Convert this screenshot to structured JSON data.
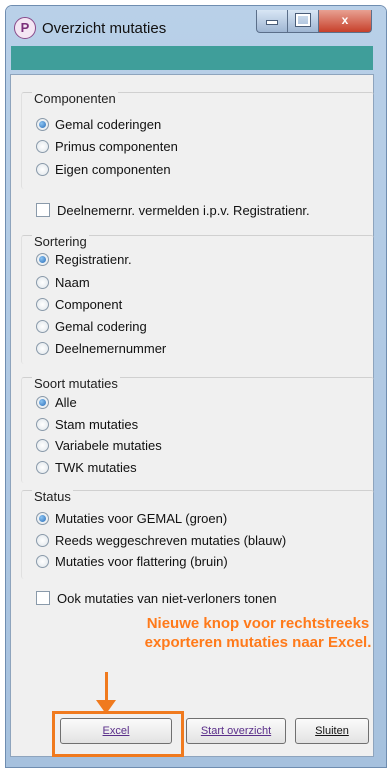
{
  "window": {
    "title": "Overzicht mutaties",
    "icon_letter": "P",
    "close_glyph": "x"
  },
  "componenten": {
    "title": "Componenten",
    "options": [
      "Gemal coderingen",
      "Primus componenten",
      "Eigen componenten"
    ],
    "selected": 0
  },
  "deelnemer_check": {
    "label": "Deelnemernr. vermelden i.p.v. Registratienr.",
    "checked": false
  },
  "sortering": {
    "title": "Sortering",
    "options": [
      "Registratienr.",
      "Naam",
      "Component",
      "Gemal codering",
      "Deelnemernummer"
    ],
    "selected": 0
  },
  "soort": {
    "title": "Soort mutaties",
    "options": [
      "Alle",
      "Stam mutaties",
      "Variabele mutaties",
      "TWK mutaties"
    ],
    "selected": 0
  },
  "status": {
    "title": "Status",
    "options": [
      "Mutaties voor GEMAL (groen)",
      "Reeds weggeschreven mutaties (blauw)",
      "Mutaties voor flattering (bruin)"
    ],
    "selected": 0
  },
  "niet_verloners_check": {
    "label": "Ook mutaties van niet-verloners tonen",
    "checked": false
  },
  "annotation": {
    "line1": "Nieuwe knop voor rechtstreeks",
    "line2": "exporteren mutaties naar Excel."
  },
  "buttons": {
    "excel": "Excel",
    "start": "Start overzicht",
    "sluiten": "Sluiten"
  },
  "colors": {
    "accent_orange": "#f07a1e",
    "teal_bar": "#3f9e9a",
    "radio_selected": "#2a6db8"
  }
}
